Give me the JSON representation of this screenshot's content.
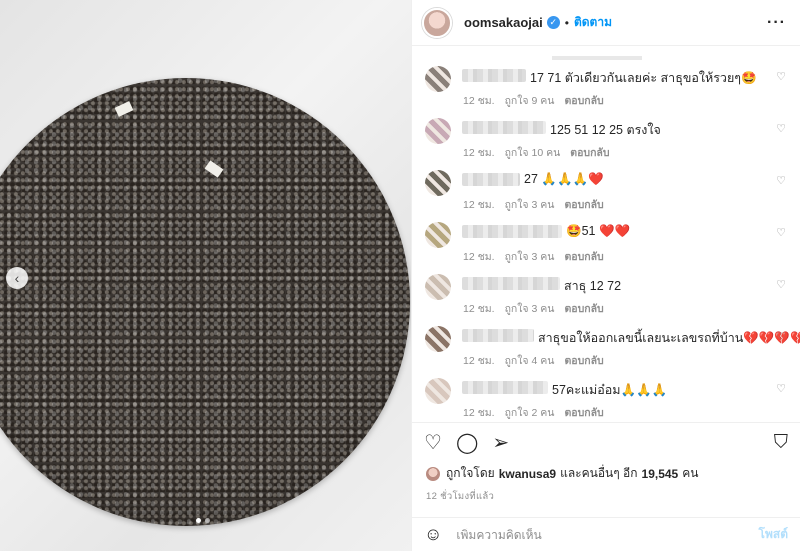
{
  "header": {
    "username": "oomsakaojai",
    "verified_icon": "verified-badge-icon",
    "dot": "•",
    "follow_label": "ติดตาม",
    "more_label": "···"
  },
  "media": {
    "prev_label": "‹",
    "dots": 2,
    "active_dot": 0
  },
  "comments": [
    {
      "text": "17 71 ตัวเดียวกันเลยค่ะ สาธุขอให้รวยๆ🤩",
      "time": "12 ชม.",
      "likes": "ถูกใจ 9 คน",
      "reply": "ตอบกลับ",
      "avatar_color": "#8a8079"
    },
    {
      "text": "125 51 12 25 ตรงใจ",
      "time": "12 ชม.",
      "likes": "ถูกใจ 10 คน",
      "reply": "ตอบกลับ",
      "avatar_color": "#c8a9b5"
    },
    {
      "text": "27 🙏🙏🙏❤️",
      "time": "12 ชม.",
      "likes": "ถูกใจ 3 คน",
      "reply": "ตอบกลับ",
      "avatar_color": "#6f6a5e"
    },
    {
      "text": "🤩51 ❤️❤️",
      "time": "12 ชม.",
      "likes": "ถูกใจ 3 คน",
      "reply": "ตอบกลับ",
      "avatar_color": "#b6a77f"
    },
    {
      "text": "สาธุ 12 72",
      "time": "12 ชม.",
      "likes": "ถูกใจ 3 คน",
      "reply": "ตอบกลับ",
      "avatar_color": "#cbbdb0"
    },
    {
      "text": "สาธุขอให้ออกเลขนี้เลยนะเลขรถที่บ้าน💔💔💔💔",
      "time": "12 ชม.",
      "likes": "ถูกใจ 4 คน",
      "reply": "ตอบกลับ",
      "avatar_color": "#8b7466"
    },
    {
      "text": "57คะแม่อ๋อม🙏🙏🙏",
      "time": "12 ชม.",
      "likes": "ถูกใจ 2 คน",
      "reply": "ตอบกลับ",
      "avatar_color": "#d8c7bd"
    }
  ],
  "actions": {
    "like_icon": "heart-icon",
    "comment_icon": "comment-icon",
    "share_icon": "share-icon",
    "save_icon": "bookmark-icon"
  },
  "likes_line": {
    "prefix": "ถูกใจโดย",
    "user": "kwanusa9",
    "middle": "และคนอื่นๆ อีก",
    "count": "19,545",
    "suffix": "คน"
  },
  "time_ago": "12 ชั่วโมงที่แล้ว",
  "add_comment": {
    "placeholder": "เพิ่มความคิดเห็น",
    "post_label": "โพสต์"
  },
  "colors": {
    "accent": "#0095f6",
    "post_disabled": "#b2dffc",
    "muted": "#8e8e8e"
  }
}
